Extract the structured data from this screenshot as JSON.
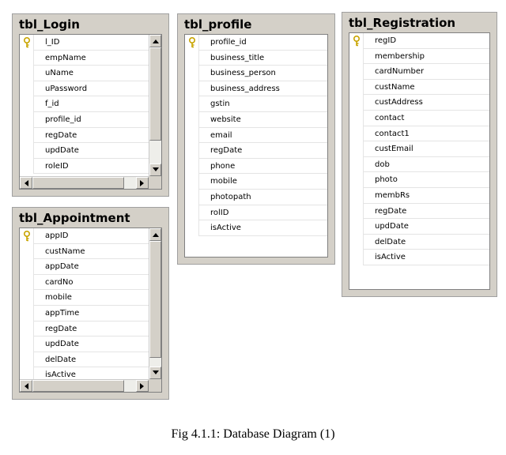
{
  "tables": {
    "login": {
      "title": "tbl_Login",
      "columns": [
        "l_ID",
        "empName",
        "uName",
        "uPassword",
        "f_id",
        "profile_id",
        "regDate",
        "updDate",
        "roleID"
      ],
      "primary_key": "l_ID"
    },
    "profile": {
      "title": "tbl_profile",
      "columns": [
        "profile_id",
        "business_title",
        "business_person",
        "business_address",
        "gstin",
        "website",
        "email",
        "regDate",
        "phone",
        "mobile",
        "photopath",
        "rolID",
        "isActive"
      ],
      "primary_key": "profile_id"
    },
    "registration": {
      "title": "tbl_Registration",
      "columns": [
        "regID",
        "membership",
        "cardNumber",
        "custName",
        "custAddress",
        "contact",
        "contact1",
        "custEmail",
        "dob",
        "photo",
        "membRs",
        "regDate",
        "updDate",
        "delDate",
        "isActive"
      ],
      "primary_key": "regID"
    },
    "appointment": {
      "title": "tbl_Appointment",
      "columns": [
        "appID",
        "custName",
        "appDate",
        "cardNo",
        "mobile",
        "appTime",
        "regDate",
        "updDate",
        "delDate",
        "isActive"
      ],
      "primary_key": "appID"
    }
  },
  "caption": "Fig 4.1.1: Database Diagram (1)",
  "icons": {
    "primary_key": "key-icon"
  },
  "colors": {
    "key_icon": "#c8a400",
    "frame": "#d4d0c8"
  }
}
